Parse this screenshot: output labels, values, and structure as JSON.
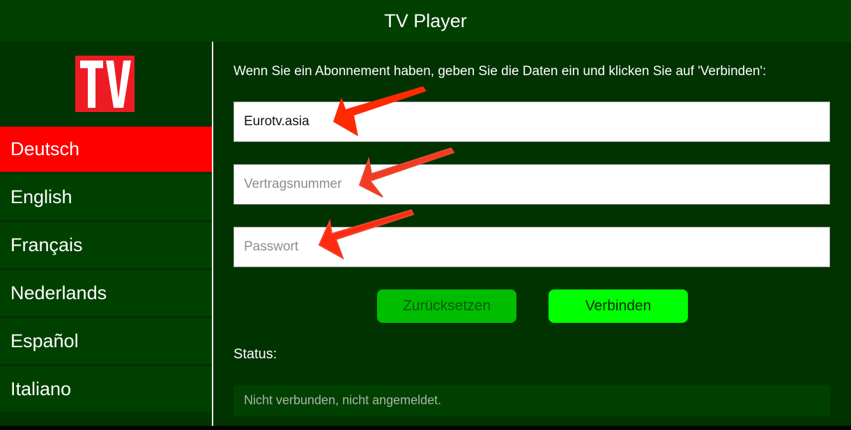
{
  "app": {
    "title": "TV Player"
  },
  "logo": {
    "text": "TV",
    "background": "#ed1c24"
  },
  "sidebar": {
    "languages": [
      {
        "label": "Deutsch",
        "active": true
      },
      {
        "label": "English",
        "active": false
      },
      {
        "label": "Français",
        "active": false
      },
      {
        "label": "Nederlands",
        "active": false
      },
      {
        "label": "Español",
        "active": false
      },
      {
        "label": "Italiano",
        "active": false
      }
    ]
  },
  "form": {
    "intro": "Wenn Sie ein Abonnement haben, geben Sie die Daten ein und klicken Sie auf 'Verbinden':",
    "server": {
      "value": "Eurotv.asia",
      "placeholder": ""
    },
    "contract": {
      "value": "",
      "placeholder": "Vertragsnummer"
    },
    "password": {
      "value": "",
      "placeholder": "Passwort"
    },
    "reset_label": "Zurücksetzen",
    "connect_label": "Verbinden"
  },
  "status": {
    "label": "Status:",
    "value": "Nicht verbunden, nicht angemeldet."
  },
  "annotations": {
    "arrow_color": "#ff2a00",
    "arrow_count": 3
  },
  "colors": {
    "header_bg": "#004100",
    "sidebar_bg": "#003400",
    "main_bg": "#003300",
    "active_language": "#ff0000",
    "reset_button": "#00bd00",
    "connect_button": "#00ff00"
  }
}
